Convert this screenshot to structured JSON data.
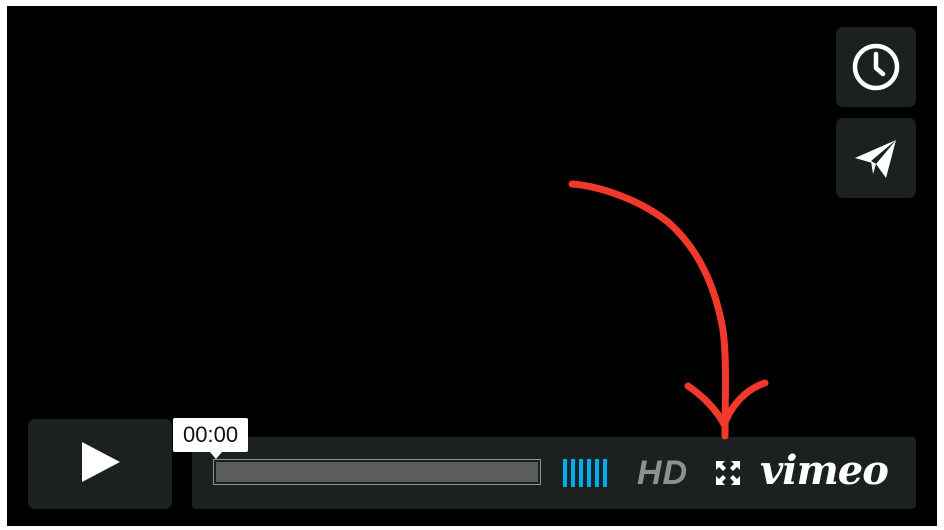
{
  "player": {
    "timecode": "00:00",
    "hd_label": "HD",
    "brand": "vimeo",
    "volume_bar_count": 6,
    "progress_fraction": 0,
    "side_buttons": [
      {
        "name": "watch-later-button",
        "icon": "clock-icon"
      },
      {
        "name": "share-button",
        "icon": "paper-plane-icon"
      }
    ],
    "controls": {
      "play_icon": "play-icon",
      "fullscreen_icon": "fullscreen-icon"
    }
  },
  "annotation": {
    "type": "hand-drawn-arrow",
    "color": "#f0392b",
    "points_to": "fullscreen-button"
  },
  "colors": {
    "background": "#000000",
    "panel": "#1b2020",
    "accent": "#00adef",
    "muted": "#8f9191"
  }
}
